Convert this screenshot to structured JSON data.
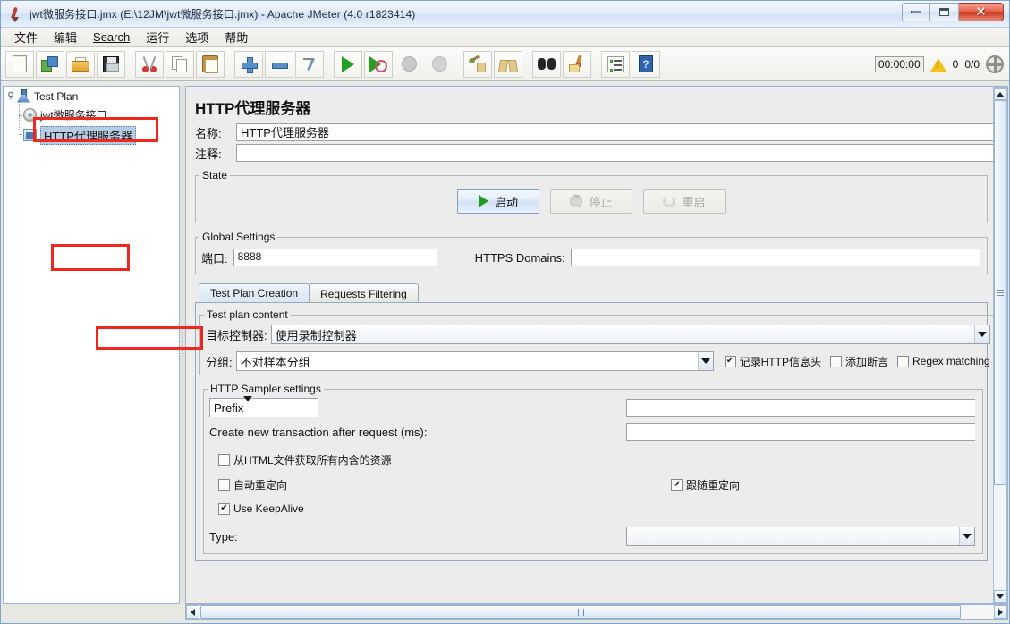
{
  "window": {
    "title": "jwt微服务接口.jmx (E:\\12JM\\jwt微服务接口.jmx) - Apache JMeter (4.0 r1823414)",
    "app_icon": "feather-pen-icon",
    "minimize_label": "",
    "maximize_label": "",
    "close_label": "✕"
  },
  "menubar": {
    "items": [
      {
        "label": "文件",
        "name": "menu-file"
      },
      {
        "label": "编辑",
        "name": "menu-edit"
      },
      {
        "label": "Search",
        "name": "menu-search",
        "mnemonic": "S"
      },
      {
        "label": "运行",
        "name": "menu-run"
      },
      {
        "label": "选项",
        "name": "menu-options"
      },
      {
        "label": "帮助",
        "name": "menu-help"
      }
    ]
  },
  "toolbar": {
    "buttons": [
      {
        "icon": "new-file-icon"
      },
      {
        "icon": "templates-icon"
      },
      {
        "icon": "open-folder-icon"
      },
      {
        "icon": "save-icon"
      },
      {
        "icon": "cut-scissors-icon"
      },
      {
        "icon": "copy-icon"
      },
      {
        "icon": "paste-clipboard-icon"
      },
      {
        "icon": "expand-plus-icon"
      },
      {
        "icon": "collapse-minus-icon"
      },
      {
        "icon": "toggle-icon"
      },
      {
        "icon": "start-play-icon"
      },
      {
        "icon": "start-no-pauses-icon"
      },
      {
        "icon": "stop-icon"
      },
      {
        "icon": "shutdown-icon"
      },
      {
        "icon": "clear-icon"
      },
      {
        "icon": "clear-all-icon"
      },
      {
        "icon": "search-binoculars-icon"
      },
      {
        "icon": "search-reset-broom-icon"
      },
      {
        "icon": "function-helper-icon"
      },
      {
        "icon": "help-book-icon"
      }
    ],
    "status": {
      "timer": "00:00:00",
      "warning_icon": "warning-triangle-icon",
      "warning_count": "0",
      "threads": "0/0",
      "thread_gauge_icon": "thread-gauge-icon"
    }
  },
  "tree": {
    "nodes": [
      {
        "label": "Test Plan",
        "icon": "test-plan-icon",
        "selected": false,
        "name": "tree-node-test-plan"
      },
      {
        "label": "jwt微服务接口",
        "icon": "thread-group-gear-icon",
        "selected": false,
        "name": "tree-node-thread-group"
      },
      {
        "label": "HTTP代理服务器",
        "icon": "http-proxy-server-icon",
        "selected": true,
        "name": "tree-node-http-proxy-server"
      }
    ]
  },
  "main": {
    "page_title": "HTTP代理服务器",
    "name_label": "名称:",
    "name_value": "HTTP代理服务器",
    "comment_label": "注释:",
    "comment_value": "",
    "state": {
      "legend": "State",
      "start_label": "启动",
      "stop_label": "停止",
      "restart_label": "重启"
    },
    "global_settings": {
      "legend": "Global Settings",
      "port_label": "端口:",
      "port_value": "8888",
      "https_domains_label": "HTTPS Domains:",
      "https_domains_value": ""
    },
    "tabs": [
      {
        "label": "Test Plan Creation",
        "active": true,
        "name": "tab-test-plan-creation"
      },
      {
        "label": "Requests Filtering",
        "active": false,
        "name": "tab-requests-filtering"
      }
    ],
    "test_plan_content": {
      "legend": "Test plan content",
      "target_controller_label": "目标控制器:",
      "target_controller_value": "使用录制控制器",
      "grouping_label": "分组:",
      "grouping_value": "不对样本分组",
      "capture_headers_label": "记录HTTP信息头",
      "capture_headers_checked": true,
      "add_assertions_label": "添加断言",
      "add_assertions_checked": false,
      "regex_matching_label": "Regex matching",
      "regex_matching_checked": false
    },
    "sampler_settings": {
      "legend": "HTTP Sampler settings",
      "naming_mode_value": "Prefix",
      "naming_value": "",
      "transaction_label": "Create new transaction after request (ms):",
      "transaction_value": "",
      "retrieve_embedded_label": "从HTML文件获取所有内含的资源",
      "retrieve_embedded_checked": false,
      "auto_redirect_label": "自动重定向",
      "auto_redirect_checked": false,
      "follow_redirect_label": "跟随重定向",
      "follow_redirect_checked": true,
      "keepalive_label": "Use KeepAlive",
      "keepalive_checked": true,
      "type_label": "Type:",
      "type_value": ""
    }
  },
  "annotations": {
    "highlight_color": "#f0271f",
    "boxes": [
      "tree-node-http-proxy-server",
      "port-input",
      "target-controller-combo"
    ]
  }
}
